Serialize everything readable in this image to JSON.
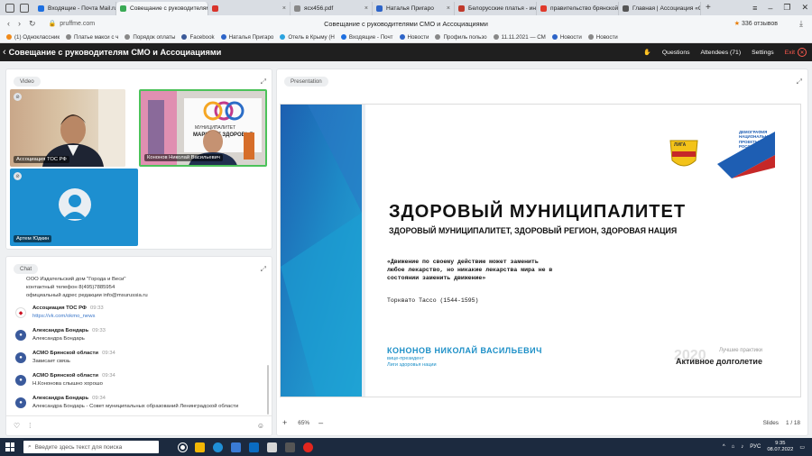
{
  "browser": {
    "tabs": [
      {
        "label": "Входящие - Почта Mail.ru",
        "color": "#1d6fe0",
        "active": false
      },
      {
        "label": "Совещание с руководителям",
        "color": "#3aaa55",
        "active": true
      },
      {
        "label": "",
        "color": "#d9342b",
        "active": false
      },
      {
        "label": "ясх456.pdf",
        "color": "#888888",
        "active": false
      },
      {
        "label": "Наталья Пригаро",
        "color": "#2d64c8",
        "active": false
      },
      {
        "label": "Белорусские платья - интер",
        "color": "#c0392b",
        "active": false
      },
      {
        "label": "правительство брянской",
        "color": "#e0392b",
        "active": false
      },
      {
        "label": "Главная | Ассоциация «Со",
        "color": "#555555",
        "active": false
      }
    ],
    "address_domain": "pruffme.com",
    "page_title": "Совещание с руководителями СМО и Ассоциациями",
    "reviews_count": "336 отзывов",
    "bookmarks": [
      {
        "label": "(1) Одноклассник",
        "color": "#f08a1b"
      },
      {
        "label": "Платье макси с ч",
        "color": "#888888"
      },
      {
        "label": "Порядок оплаты",
        "color": "#888888"
      },
      {
        "label": "Facebook",
        "color": "#3b5998"
      },
      {
        "label": "Наталья Пригаро",
        "color": "#2d64c8"
      },
      {
        "label": "Отель в Крыму (Н",
        "color": "#2aa3df"
      },
      {
        "label": "Входящие - Почт",
        "color": "#1d6fe0"
      },
      {
        "label": "Новости",
        "color": "#2d64c8"
      },
      {
        "label": "Профиль пользо",
        "color": "#888888"
      },
      {
        "label": "11.11.2021 — СМ",
        "color": "#888888"
      },
      {
        "label": "Новости",
        "color": "#2d64c8"
      },
      {
        "label": "Новости",
        "color": "#888888"
      }
    ]
  },
  "app": {
    "title": "Совещание с руководителям СМО и Ассоциациями",
    "nav": {
      "questions": "Questions",
      "attendees": "Attendees (71)",
      "settings": "Settings",
      "exit": "Exit"
    }
  },
  "video": {
    "label": "Video",
    "tiles": [
      {
        "name": "Ассоциация ТОС РФ"
      },
      {
        "name": "Кононов Николай Васильевич"
      },
      {
        "name": "Артем Юдкин"
      }
    ],
    "banner_text": "МУНИЦИПАЛИТЕТ",
    "banner_text2": "МАРШРУТ ЗДОРОВЬЯ"
  },
  "chat": {
    "label": "Chat",
    "intro": [
      "ООО Издательский дом \"Города и Веси\"",
      "контактный телефон 8(495)7885954",
      "официальный адрес редакции info@msurussia.ru"
    ],
    "messages": [
      {
        "author": "Ассоциация ТОС РФ",
        "time": "09:33",
        "text": "https://vk.com/okmo_news",
        "is_link": true
      },
      {
        "author": "Александра Бондарь",
        "time": "09:33",
        "text": "Александра Бондарь"
      },
      {
        "author": "АСМО Брянской области",
        "time": "09:34",
        "text": "Зависает связь"
      },
      {
        "author": "АСМО Брянской области",
        "time": "09:34",
        "text": "Н.Кононова слышно хорошо"
      },
      {
        "author": "Александра Бондарь",
        "time": "09:34",
        "text": "Александра Бондарь - Совет муниципальных образований Ленинградской области"
      }
    ]
  },
  "presentation": {
    "label": "Presentation",
    "slide": {
      "heading": "ЗДОРОВЫЙ МУНИЦИПАЛИТЕТ",
      "subheading": "ЗДОРОВЫЙ МУНИЦИПАЛИТЕТ, ЗДОРОВЫЙ РЕГИОН, ЗДОРОВАЯ НАЦИЯ",
      "quote": "«Движение по своему действию может заменить любое лекарство, но никакие лекарства мира не в состоянии заменить движение»",
      "quote_author": "Торквато Тассо (1544-1595)",
      "speaker_name": "КОНОНОВ НИКОЛАЙ ВАСИЛЬЕВИЧ",
      "speaker_role1": "вице-президент",
      "speaker_role2": "Лиги здоровья нации",
      "year": "2020",
      "practices_label": "Лучшие практики",
      "practices_name": "Активное долголетие",
      "logo_league": "ЛИГА",
      "np_line1": "ДЕМОГРАФИЯ",
      "np_line2": "НАЦИОНАЛЬНЫЕ",
      "np_line3": "ПРОЕКТЫ",
      "np_line4": "РОССИИ"
    },
    "zoom": "65%",
    "slides_label": "Slides",
    "slide_counter": "1 / 18"
  },
  "taskbar": {
    "search_placeholder": "Введите здесь текст для поиска",
    "lang": "РУС",
    "time": "9:35",
    "date": "08.07.2022"
  }
}
